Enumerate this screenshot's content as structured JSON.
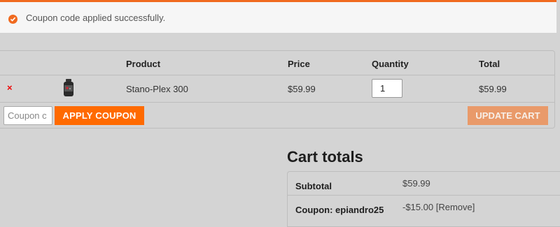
{
  "notice": {
    "icon": "check-circle-icon",
    "message": "Coupon code applied successfully."
  },
  "cart": {
    "headers": {
      "product": "Product",
      "price": "Price",
      "quantity": "Quantity",
      "total": "Total"
    },
    "items": [
      {
        "name": "Stano-Plex 300",
        "price": "$59.99",
        "quantity": "1",
        "total": "$59.99"
      }
    ],
    "coupon_placeholder": "Coupon c",
    "apply_coupon_label": "APPLY COUPON",
    "update_cart_label": "UPDATE CART"
  },
  "totals": {
    "title": "Cart totals",
    "subtotal_label": "Subtotal",
    "subtotal_value": "$59.99",
    "coupon_label": "Coupon: epiandro25",
    "coupon_value": "-$15.00",
    "coupon_remove": "[Remove]"
  },
  "colors": {
    "accent": "#ff6a00",
    "remove": "#e00000"
  }
}
